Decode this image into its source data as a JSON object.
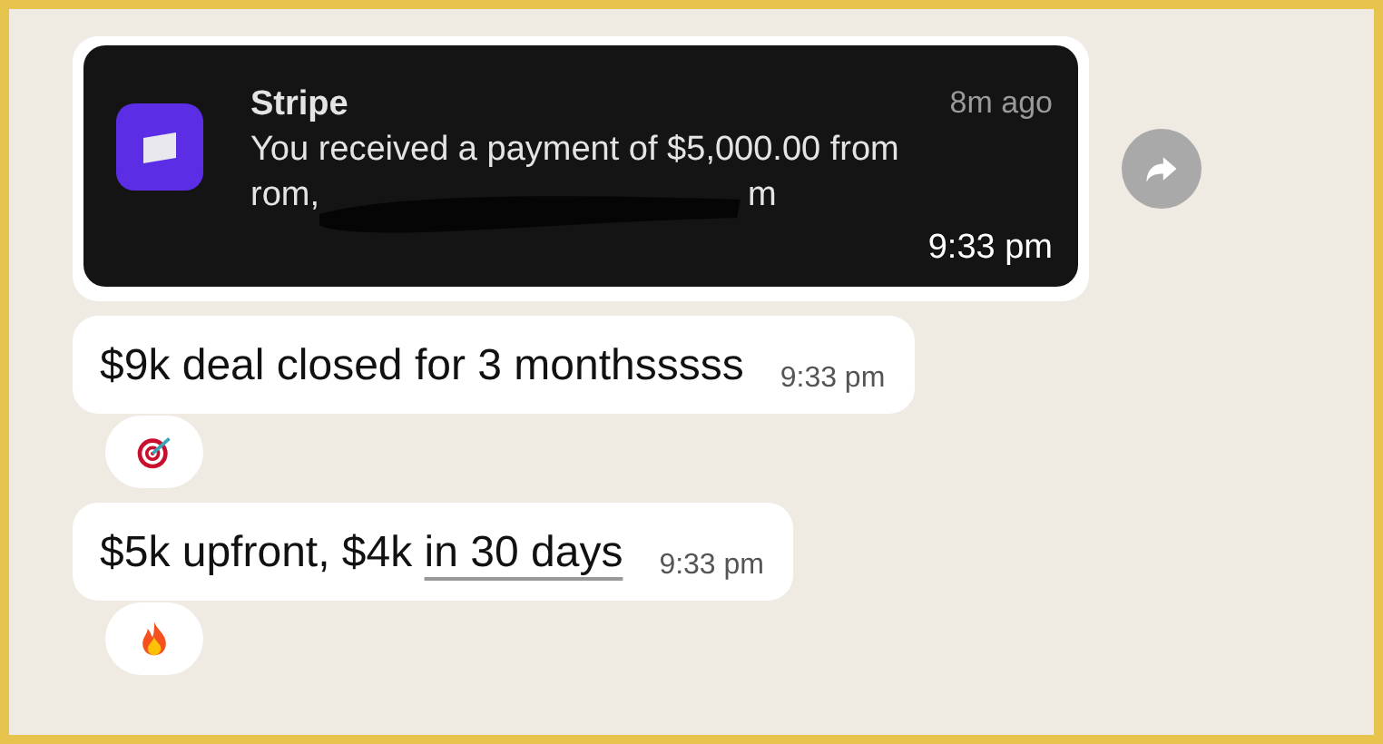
{
  "notification": {
    "app": "Stripe",
    "age": "8m ago",
    "body": "You received a payment of $5,000.00 from",
    "sender_start": "rom,",
    "sender_end": "m",
    "time": "9:33 pm"
  },
  "messages": [
    {
      "parts": [
        {
          "text": "$9k deal closed for 3 monthsssss",
          "kind": "plain"
        }
      ],
      "time": "9:33 pm",
      "reaction": {
        "kind": "target"
      }
    },
    {
      "parts": [
        {
          "text": "$5k upfront, $4k ",
          "kind": "plain"
        },
        {
          "text": "in 30 days",
          "kind": "link"
        }
      ],
      "time": "9:33 pm",
      "reaction": {
        "kind": "fire"
      }
    }
  ]
}
